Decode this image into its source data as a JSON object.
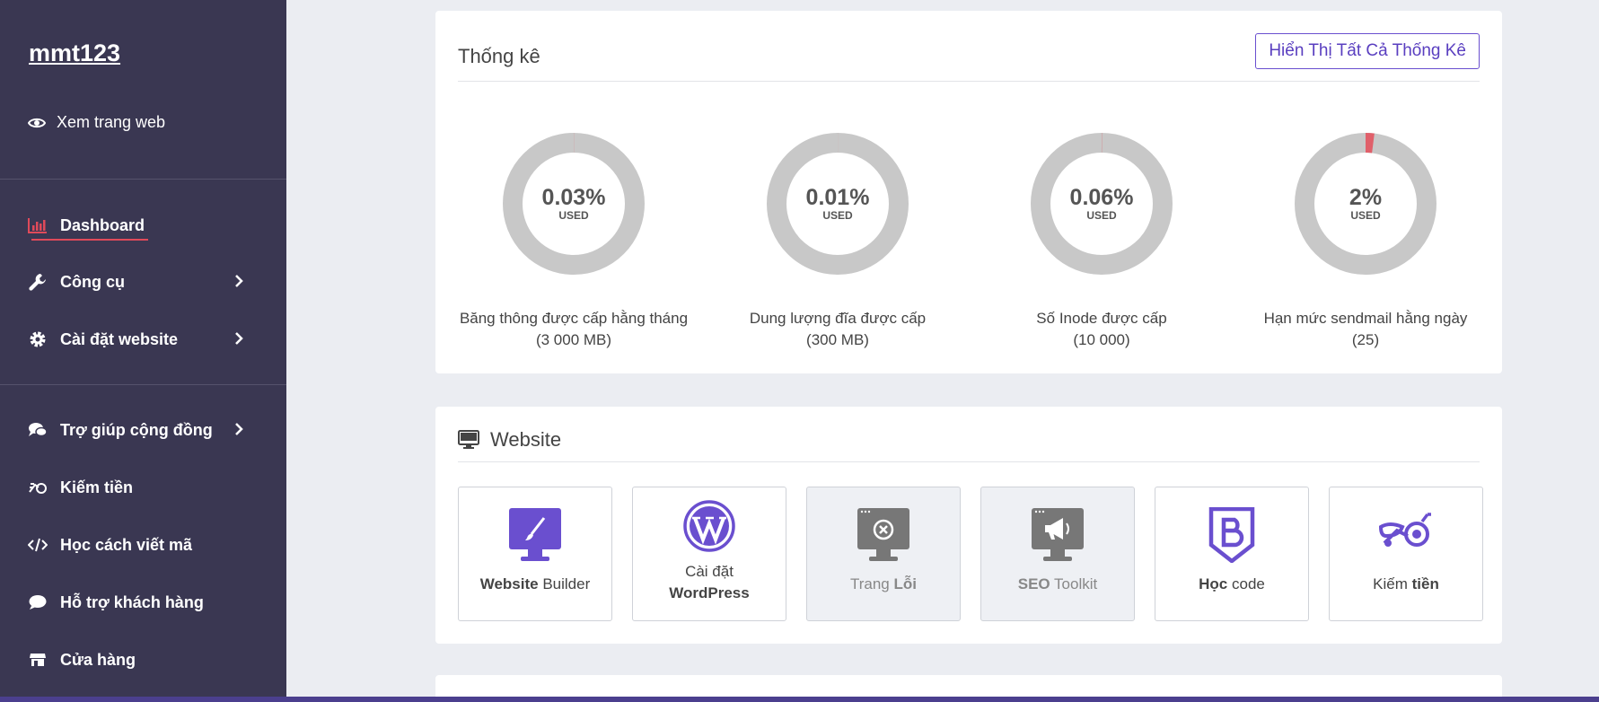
{
  "sidebar": {
    "brand": "mmt123",
    "view_site": "Xem trang web",
    "nav": [
      {
        "label": "Dashboard",
        "icon": "chart-bar-icon",
        "active": true
      },
      {
        "label": "Công cụ",
        "icon": "wrench-icon"
      },
      {
        "label": "Cài đặt website",
        "icon": "gear-icon"
      },
      {
        "label": "Trợ giúp cộng đồng",
        "icon": "comments-icon"
      },
      {
        "label": "Kiếm tiền",
        "icon": "money-icon"
      },
      {
        "label": "Học cách viết mã",
        "icon": "code-icon"
      },
      {
        "label": "Hỗ trợ khách hàng",
        "icon": "comment-icon"
      },
      {
        "label": "Cửa hàng",
        "icon": "store-icon"
      }
    ]
  },
  "stats": {
    "title": "Thống kê",
    "show_all": "Hiển Thị Tất Cả Thống Kê",
    "used_label": "USED",
    "items": [
      {
        "pct": "0.03%",
        "value": 0.03,
        "label": "Băng thông được cấp hằng tháng",
        "sub": "(3 000 MB)"
      },
      {
        "pct": "0.01%",
        "value": 0.01,
        "label": "Dung lượng đĩa được cấp",
        "sub": "(300 MB)"
      },
      {
        "pct": "0.06%",
        "value": 0.06,
        "label": "Số Inode được cấp",
        "sub": "(10 000)"
      },
      {
        "pct": "2%",
        "value": 2,
        "label": "Hạn mức sendmail hằng ngày",
        "sub": "(25)"
      }
    ],
    "colors": {
      "track": "#c8c8c8",
      "fill": "#e0606a"
    }
  },
  "website": {
    "title": "Website",
    "tiles": [
      {
        "bold": "Website",
        "rest": " Builder",
        "icon": "brush-monitor-icon"
      },
      {
        "line1": "Cài đặt",
        "line2": "WordPress",
        "icon": "wordpress-icon"
      },
      {
        "pre": "Trang ",
        "bold": "Lỗi",
        "icon": "error-monitor-icon"
      },
      {
        "bold": "SEO",
        "rest": " Toolkit",
        "icon": "megaphone-monitor-icon"
      },
      {
        "bold": "Học",
        "rest": " code",
        "icon": "bootstrap-icon"
      },
      {
        "pre": "Kiếm ",
        "bold": "tiền",
        "icon": "moped-icon"
      }
    ]
  },
  "accent": "#6a4fcf"
}
